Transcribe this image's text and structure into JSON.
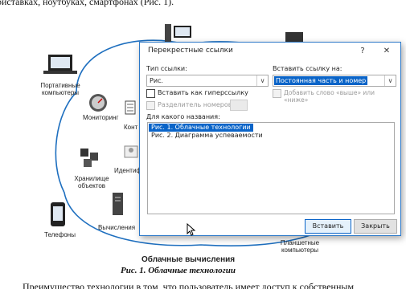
{
  "document": {
    "top_text": "риставках, ноутбуках, смартфонах (Рис. 1).",
    "bottom_text": "Преимущество технологии в том, что пользователь имеет доступ к собственным",
    "figure_title": "Облачные вычисления",
    "caption": "Рис. 1. Облачные технологии"
  },
  "figure_labels": {
    "portable": "Портативные компьютеры",
    "monitoring": "Мониторинг",
    "content": "Конт",
    "identity": "Идентиф",
    "storage": "Хранилище объектов",
    "computing": "Вычисления",
    "phones": "Телефоны",
    "tablets": "Планшетные компьютеры"
  },
  "dialog": {
    "title": "Перекрестные ссылки",
    "help": "?",
    "close": "✕",
    "ref_type_label": "Тип ссылки:",
    "ref_type_value": "Рис.",
    "insert_ref_label": "Вставить ссылку на:",
    "insert_ref_value": "Постоянная часть и номер",
    "hyperlink_label": "Вставить как гиперссылку",
    "above_below_label": "Добавить слово «выше» или «ниже»",
    "separator_label": "Разделитель номеров",
    "for_which_label": "Для какого названия:",
    "items": [
      "Рис. 1. Облачные технологии",
      "Рис. 2. Диаграмма успеваемости"
    ],
    "insert_button": "Вставить",
    "close_button": "Закрыть",
    "dropdown_arrow": "∨"
  },
  "colors": {
    "accent": "#0a64c8",
    "border": "#2b78c8"
  }
}
